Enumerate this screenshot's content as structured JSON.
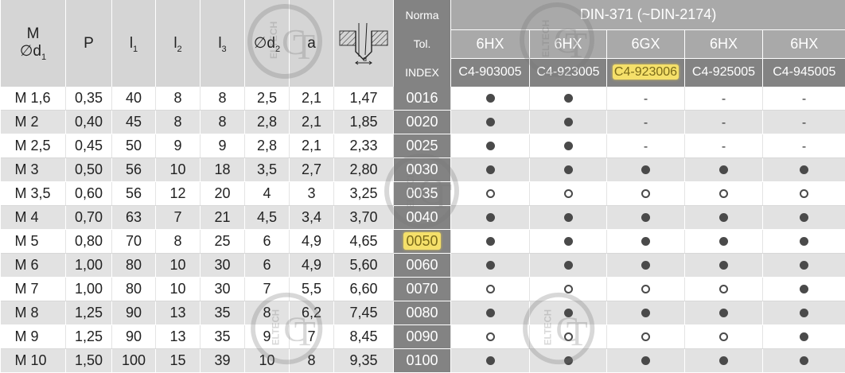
{
  "header": {
    "m": "M",
    "m_sub": "∅d",
    "m_sub_index": "1",
    "p": "P",
    "l1": "l",
    "l1_index": "1",
    "l2": "l",
    "l2_index": "2",
    "l3": "l",
    "l3_index": "3",
    "d2": "∅d",
    "d2_index": "2",
    "a": "a",
    "diagram_label": "d",
    "norma_label": "Norma",
    "tol_label": "Tol.",
    "index_label": "INDEX",
    "norma_value": "DIN-371 (~DIN-2174)"
  },
  "columns": [
    {
      "tol": "6HX",
      "index": "C4-903005",
      "highlight": false
    },
    {
      "tol": "6HX",
      "index": "C4-923005",
      "highlight": false
    },
    {
      "tol": "6GX",
      "index": "C4-923006",
      "highlight": true
    },
    {
      "tol": "6HX",
      "index": "C4-925005",
      "highlight": false
    },
    {
      "tol": "6HX",
      "index": "C4-945005",
      "highlight": false
    }
  ],
  "rows": [
    {
      "m": "M 1,6",
      "p": "0,35",
      "l1": "40",
      "l2": "8",
      "l3": "8",
      "d2": "2,5",
      "a": "2,1",
      "d": "1,47",
      "index": "0016",
      "avail": [
        "filled",
        "filled",
        "none",
        "none",
        "none"
      ]
    },
    {
      "m": "M 2",
      "p": "0,40",
      "l1": "45",
      "l2": "8",
      "l3": "8",
      "d2": "2,8",
      "a": "2,1",
      "d": "1,85",
      "index": "0020",
      "avail": [
        "filled",
        "filled",
        "none",
        "none",
        "none"
      ]
    },
    {
      "m": "M 2,5",
      "p": "0,45",
      "l1": "50",
      "l2": "9",
      "l3": "9",
      "d2": "2,8",
      "a": "2,1",
      "d": "2,33",
      "index": "0025",
      "avail": [
        "filled",
        "filled",
        "none",
        "none",
        "none"
      ]
    },
    {
      "m": "M 3",
      "p": "0,50",
      "l1": "56",
      "l2": "10",
      "l3": "18",
      "d2": "3,5",
      "a": "2,7",
      "d": "2,80",
      "index": "0030",
      "avail": [
        "filled",
        "filled",
        "filled",
        "filled",
        "filled"
      ]
    },
    {
      "m": "M 3,5",
      "p": "0,60",
      "l1": "56",
      "l2": "12",
      "l3": "20",
      "d2": "4",
      "a": "3",
      "d": "3,25",
      "index": "0035",
      "avail": [
        "open",
        "open",
        "open",
        "open",
        "open"
      ]
    },
    {
      "m": "M 4",
      "p": "0,70",
      "l1": "63",
      "l2": "7",
      "l3": "21",
      "d2": "4,5",
      "a": "3,4",
      "d": "3,70",
      "index": "0040",
      "avail": [
        "filled",
        "filled",
        "filled",
        "filled",
        "filled"
      ]
    },
    {
      "m": "M 5",
      "p": "0,80",
      "l1": "70",
      "l2": "8",
      "l3": "25",
      "d2": "6",
      "a": "4,9",
      "d": "4,65",
      "index": "0050",
      "highlight": true,
      "avail": [
        "filled",
        "filled",
        "filled",
        "filled",
        "filled"
      ]
    },
    {
      "m": "M 6",
      "p": "1,00",
      "l1": "80",
      "l2": "10",
      "l3": "30",
      "d2": "6",
      "a": "4,9",
      "d": "5,60",
      "index": "0060",
      "avail": [
        "filled",
        "filled",
        "filled",
        "filled",
        "filled"
      ]
    },
    {
      "m": "M 7",
      "p": "1,00",
      "l1": "80",
      "l2": "10",
      "l3": "30",
      "d2": "7",
      "a": "5,5",
      "d": "6,60",
      "index": "0070",
      "avail": [
        "open",
        "open",
        "open",
        "open",
        "filled"
      ]
    },
    {
      "m": "M 8",
      "p": "1,25",
      "l1": "90",
      "l2": "13",
      "l3": "35",
      "d2": "8",
      "a": "6,2",
      "d": "7,45",
      "index": "0080",
      "avail": [
        "filled",
        "filled",
        "filled",
        "filled",
        "filled"
      ]
    },
    {
      "m": "M 9",
      "p": "1,25",
      "l1": "90",
      "l2": "13",
      "l3": "35",
      "d2": "9",
      "a": "7",
      "d": "8,45",
      "index": "0090",
      "avail": [
        "open",
        "open",
        "open",
        "open",
        "filled"
      ]
    },
    {
      "m": "M 10",
      "p": "1,50",
      "l1": "100",
      "l2": "15",
      "l3": "39",
      "d2": "10",
      "a": "8",
      "d": "9,35",
      "index": "0100",
      "avail": [
        "filled",
        "filled",
        "filled",
        "filled",
        "filled"
      ]
    }
  ],
  "symbols": {
    "none": "-"
  },
  "watermark": {
    "text": "ELTECH",
    "letters": "CT"
  },
  "colors": {
    "header_light": "#d5d5d5",
    "header_dark": "#838383",
    "header_mid": "#a9a9a9",
    "row_alt": "#e2e2e2",
    "highlight": "#f5e06a",
    "dot": "#4a4a4a"
  }
}
